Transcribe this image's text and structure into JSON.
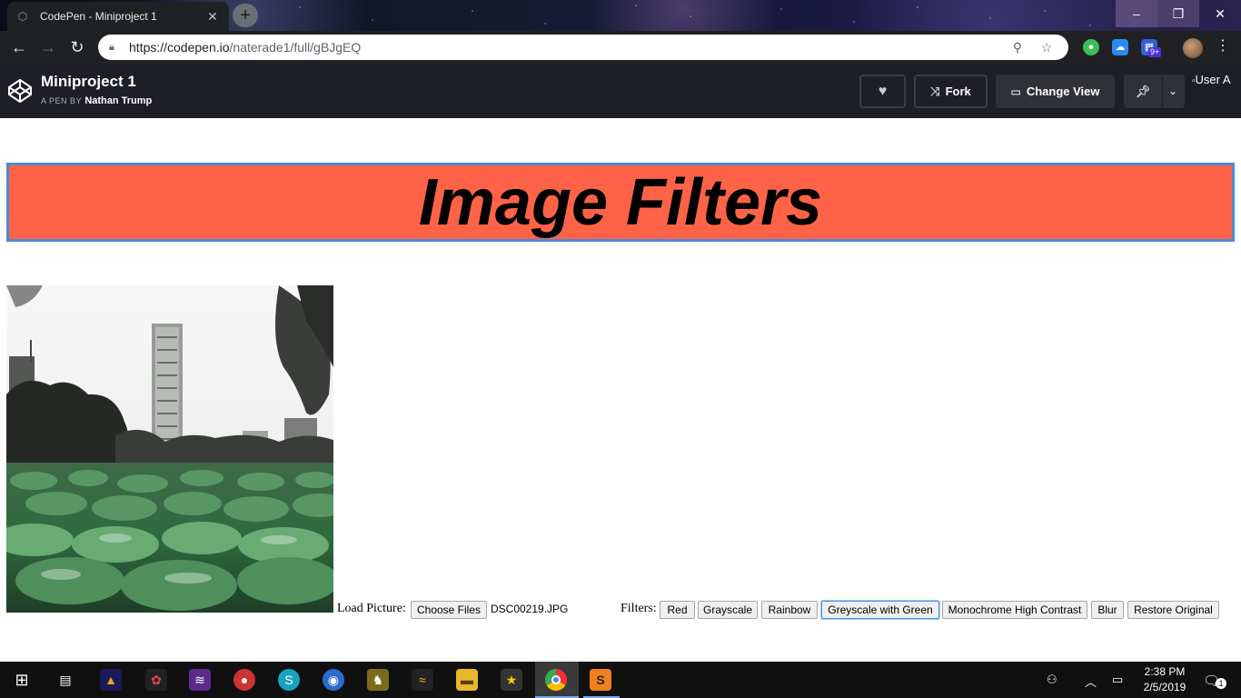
{
  "browser": {
    "tab_title": "CodePen - Miniproject 1",
    "url_base": "https://codepen.io",
    "url_path": "/naterade1/full/gBJgEQ",
    "extension_badge": "9+"
  },
  "codepen": {
    "pen_title": "Miniproject 1",
    "by_prefix": "A PEN BY",
    "author": "Nathan Trump",
    "fork_label": "Fork",
    "change_view_label": "Change View",
    "user_avatar_alt": "User A"
  },
  "page": {
    "heading": "Image Filters",
    "load_label": "Load Picture:",
    "choose_files_label": "Choose Files",
    "file_name": "DSC00219.JPG",
    "filters_label": "Filters:",
    "filters": [
      "Red",
      "Grayscale",
      "Rainbow",
      "Greyscale with Green",
      "Monochrome High Contrast",
      "Blur",
      "Restore Original"
    ],
    "colors": {
      "banner_bg": "#ff6347",
      "banner_border": "#4a8ad8"
    }
  },
  "taskbar": {
    "time": "2:38 PM",
    "date": "2/5/2019",
    "notification_count": "1"
  }
}
